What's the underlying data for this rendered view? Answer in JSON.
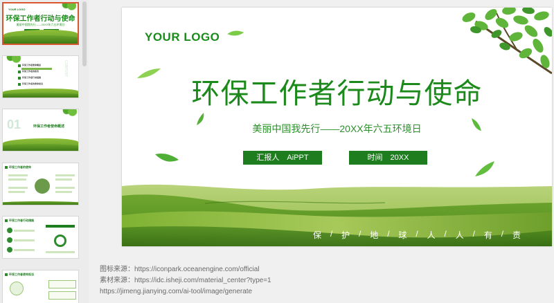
{
  "thumbnails": {
    "slide1": {
      "logo": "YOUR LOGO",
      "title": "环保工作者行动与使命",
      "subtitle": "美丽中国我先行——20XX年六五环境日"
    },
    "slide2": {
      "vertical": "CONTENT",
      "items": [
        "环保工作者使命概述",
        "环保工作者的职责",
        "环保工作者行动措施",
        "环保工作者的使命担当"
      ]
    },
    "slide3": {
      "number": "01",
      "heading": "环保工作者使命概述"
    },
    "slide4": {
      "heading": "环保工作者的使命"
    },
    "slide5": {
      "heading": "环保工作者行动措施"
    },
    "slide6": {
      "heading": "环保工作者使命担当"
    }
  },
  "slide": {
    "logo": "YOUR LOGO",
    "title": "环保工作者行动与使命",
    "subtitle": "美丽中国我先行——20XX年六五环境日",
    "reporter": "汇报人　AiPPT",
    "time": "时间　20XX",
    "slogan_chars": [
      "保",
      "护",
      "地",
      "球",
      "人",
      "人",
      "有",
      "责"
    ],
    "colors": {
      "title_green": "#1b8a1b",
      "button_green": "#1e7d1e",
      "grass_light": "#8cc03f",
      "grass_dark": "#4f8f20"
    }
  },
  "footer": {
    "line1": "图标来源：https://iconpark.oceanengine.com/official",
    "line2": "素材来源：https://idc.isheji.com/material_center?type=1",
    "line3": "https://jimeng.jianying.com/ai-tool/image/generate"
  }
}
